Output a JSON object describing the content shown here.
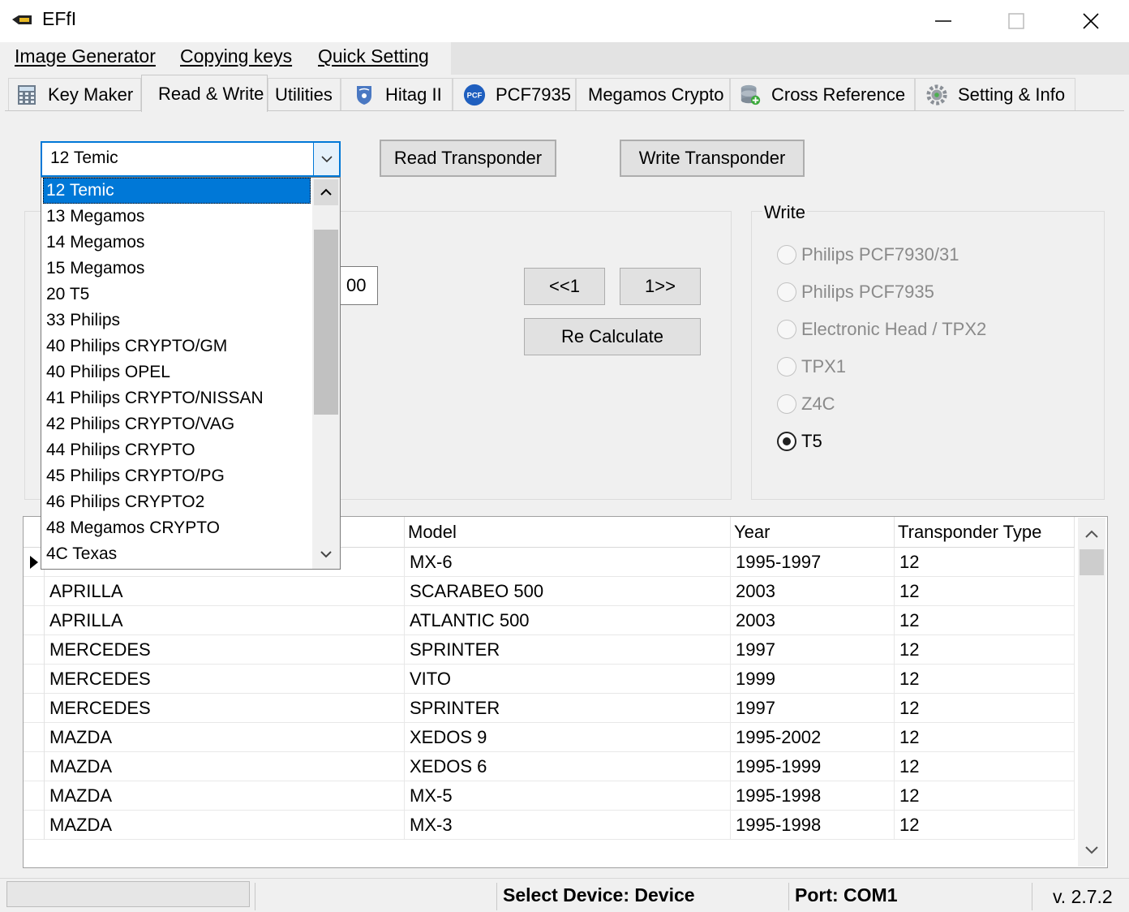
{
  "window": {
    "title": "EFfI",
    "controls": {
      "minimize": "—",
      "maximize": "☐",
      "close": "✕"
    }
  },
  "menu": [
    "Image Generator",
    "Copying keys",
    "Quick Setting"
  ],
  "tabs": [
    {
      "label": "Key Maker",
      "icon": "calculator-icon"
    },
    {
      "label": "Read & Write",
      "icon": "",
      "active": true
    },
    {
      "label": "Utilities",
      "icon": ""
    },
    {
      "label": "Hitag II",
      "icon": "philips-shield-icon"
    },
    {
      "label": "PCF7935",
      "icon": "pcf-logo-icon"
    },
    {
      "label": "Megamos Crypto",
      "icon": ""
    },
    {
      "label": "Cross Reference",
      "icon": "database-icon"
    },
    {
      "label": "Setting & Info",
      "icon": "gear-icon"
    }
  ],
  "transponder_select": {
    "value": "12 Temic",
    "options": [
      "12 Temic",
      "13 Megamos",
      "14 Megamos",
      "15 Megamos",
      "20 T5",
      "33 Philips",
      "40 Philips CRYPTO/GM",
      "40 Philips OPEL",
      "41 Philips CRYPTO/NISSAN",
      "42 Philips CRYPTO/VAG",
      "44 Philips CRYPTO",
      "45 Philips CRYPTO/PG",
      "46 Philips CRYPTO2",
      "48 Megamos CRYPTO",
      "4C Texas"
    ],
    "selected_index": 0
  },
  "buttons": {
    "read": "Read Transponder",
    "write": "Write Transponder",
    "prev": "<<1",
    "next": "1>>",
    "recalc": "Re Calculate"
  },
  "field_value": "00",
  "write_group": {
    "legend": "Write",
    "options": [
      {
        "label": "Philips PCF7930/31",
        "checked": false
      },
      {
        "label": "Philips PCF7935",
        "checked": false
      },
      {
        "label": "Electronic Head / TPX2",
        "checked": false
      },
      {
        "label": "TPX1",
        "checked": false
      },
      {
        "label": "Z4C",
        "checked": false
      },
      {
        "label": "T5",
        "checked": true
      }
    ]
  },
  "grid": {
    "columns": [
      "",
      "Model",
      "Year",
      "Transponder Type"
    ],
    "rows": [
      [
        "",
        "MX-6",
        "1995-1997",
        "12"
      ],
      [
        "APRILLA",
        "SCARABEO 500",
        "2003",
        "12"
      ],
      [
        "APRILLA",
        "ATLANTIC 500",
        "2003",
        "12"
      ],
      [
        "MERCEDES",
        "SPRINTER",
        "1997",
        "12"
      ],
      [
        "MERCEDES",
        "VITO",
        "1999",
        "12"
      ],
      [
        "MERCEDES",
        "SPRINTER",
        "1997",
        "12"
      ],
      [
        "MAZDA",
        "XEDOS 9",
        "1995-2002",
        "12"
      ],
      [
        "MAZDA",
        "XEDOS 6",
        "1995-1999",
        "12"
      ],
      [
        "MAZDA",
        "MX-5",
        "1995-1998",
        "12"
      ],
      [
        "MAZDA",
        "MX-3",
        "1995-1998",
        "12"
      ]
    ]
  },
  "status": {
    "device": "Select Device:  Device",
    "port": "Port:  COM1",
    "version": "v. 2.7.2"
  }
}
